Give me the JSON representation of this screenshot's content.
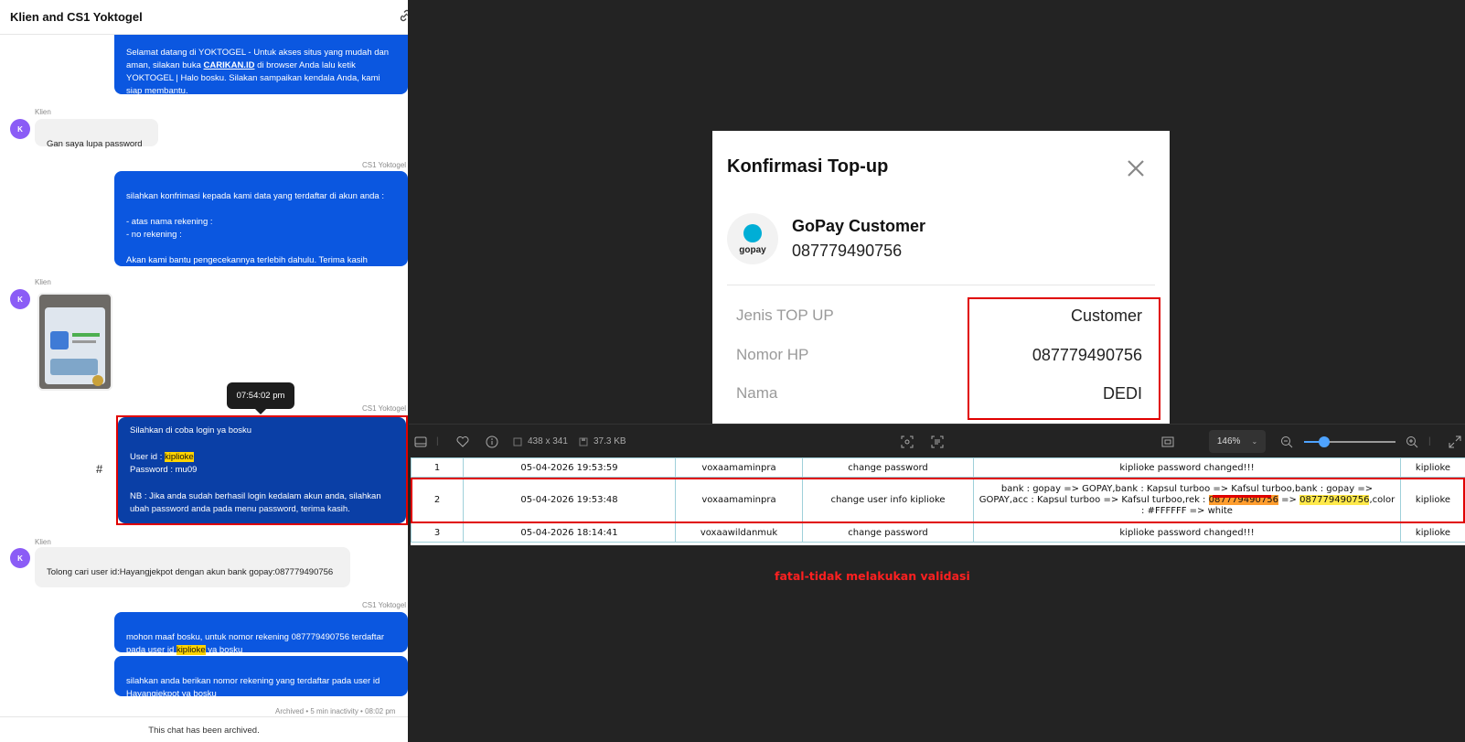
{
  "chat": {
    "title": "Klien and CS1 Yoktogel",
    "messages": [
      {
        "sender": "CS1 Yoktogel",
        "text_before": "Selamat datang di YOKTOGEL - Untuk akses situs yang mudah dan aman, silakan buka ",
        "link": "CARIKAN.ID",
        "text_after": " di browser Anda lalu ketik YOKTOGEL | Halo bosku. Silakan sampaikan kendala Anda, kami siap membantu."
      },
      {
        "sender": "Klien",
        "text": "Gan saya lupa password"
      },
      {
        "sender": "CS1 Yoktogel",
        "text": "silahkan konfrimasi kepada kami data yang terdaftar di akun anda :\n\n- atas nama rekening :\n- no rekening :\n\nAkan kami bantu pengecekannya terlebih dahulu. Terima kasih"
      },
      {
        "sender": "Klien",
        "image": "chat-photo"
      },
      {
        "sender": "CS1 Yoktogel",
        "line1": "Silahkan di coba login ya bosku",
        "userid_label": "User id : ",
        "userid": "kiplioke",
        "password": "Password : mu09",
        "note": "NB : Jika anda sudah berhasil login kedalam akun anda, silahkan ubah password anda pada menu password, terima kasih."
      },
      {
        "sender": "Klien",
        "text": "Tolong cari user id:Hayangjekpot dengan akun bank gopay:087779490756"
      },
      {
        "sender": "CS1 Yoktogel",
        "before": "mohon maaf bosku, untuk nomor rekening 087779490756 terdaftar pada user id ",
        "highlight": "kiplioke",
        "after": " ya bosku"
      },
      {
        "sender": "",
        "text": "silahkan anda berikan nomor rekening yang terdaftar pada user id Hayangjekpot ya bosku"
      }
    ],
    "avatar_letter": "K",
    "tooltip": "07:54:02 pm",
    "hash": "#",
    "archived_meta": "Archived • 5 min inactivity • 08:02 pm",
    "archived_notice": "This chat has been archived."
  },
  "modal": {
    "title": "Konfirmasi Top-up",
    "logo_text": "gopay",
    "customer_name": "GoPay Customer",
    "customer_phone": "087779490756",
    "fields": [
      {
        "label": "Jenis TOP UP",
        "value": "Customer"
      },
      {
        "label": "Nomor HP",
        "value": "087779490756"
      },
      {
        "label": "Nama",
        "value": "DEDI"
      }
    ]
  },
  "toolbar": {
    "dimensions": "438 x 341",
    "filesize": "37.3 KB",
    "zoom": "146%",
    "zoom_level": 0.22
  },
  "log": {
    "rows": [
      {
        "no": "1",
        "date": "05-04-2026 19:53:59",
        "user": "voxaamaminpra",
        "action": "change password",
        "detail": "kiplioke password changed!!!",
        "target": "kiplioke"
      },
      {
        "no": "2",
        "date": "05-04-2026 19:53:48",
        "user": "voxaamaminpra",
        "action": "change user info kiplioke",
        "detail_parts": [
          "bank : gopay => GOPAY,bank : Kapsul turboo => Kafsul turboo,bank : gopay => GOPAY,acc : Kapsul turboo => Kafsul turboo,rek : ",
          "087779490756",
          " => ",
          "087779490756",
          ",color : #FFFFFF => white"
        ],
        "target": "kiplioke"
      },
      {
        "no": "3",
        "date": "05-04-2026 18:14:41",
        "user": "voxaawildanmuk",
        "action": "change password",
        "detail": "kiplioke password changed!!!",
        "target": "kiplioke"
      }
    ]
  },
  "annotation": "fatal-tidak melakukan validasi",
  "colors": {
    "accent": "#0b57e0",
    "highlight_red": "#e00000",
    "avatar": "#8b5cf6"
  }
}
